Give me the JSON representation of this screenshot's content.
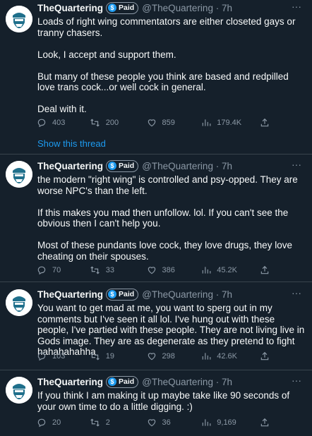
{
  "tweets": [
    {
      "name": "TheQuartering",
      "badge": "Paid",
      "badge_icon": "$",
      "handle": "@TheQuartering · 7h",
      "paragraphs": [
        "Loads of right wing commentators are either closeted gays or tranny chasers.",
        "Look, I accept and support them.",
        "But many of these people you think are based and redpilled love trans cock...or well cock in general.",
        "Deal with it."
      ],
      "replies": "403",
      "retweets": "200",
      "likes": "859",
      "views": "179.4K"
    },
    {
      "name": "TheQuartering",
      "badge": "Paid",
      "badge_icon": "$",
      "handle": "@TheQuartering · 7h",
      "paragraphs": [
        "the modern \"right wing\" is controlled and psy-opped.  They are worse NPC's than the left.",
        "If this makes you mad then unfollow.  lol.  If you can't see the obvious then I can't help you.",
        "Most of these pundants love cock, they love drugs, they love cheating on their spouses."
      ],
      "replies": "70",
      "retweets": "33",
      "likes": "386",
      "views": "45.2K"
    },
    {
      "name": "TheQuartering",
      "badge": "Paid",
      "badge_icon": "$",
      "handle": "@TheQuartering · 7h",
      "paragraphs": [
        "You want to get  mad at me, you want to sperg out in my comments but I've seen it all lol.  I've hung out with these people, I've partied with these people.  They are not living live in Gods image.  They are as degenerate as they pretend to fight hahahahahha"
      ],
      "replies": "103",
      "retweets": "19",
      "likes": "298",
      "views": "42.6K"
    },
    {
      "name": "TheQuartering",
      "badge": "Paid",
      "badge_icon": "$",
      "handle": "@TheQuartering · 7h",
      "paragraphs": [
        "If you think I am making it up maybe take like 90 seconds of your own time to do a little digging. :)"
      ],
      "replies": "20",
      "retweets": "2",
      "likes": "36",
      "views": "9,169"
    }
  ],
  "show_thread_label": "Show this thread",
  "more_icon": "···",
  "icons": {
    "reply": "reply-icon",
    "retweet": "retweet-icon",
    "like": "heart-icon",
    "views": "views-icon",
    "share": "share-icon",
    "avatar": "avatar-logo",
    "paid": "paid-badge-icon"
  },
  "colors": {
    "background": "#15202b",
    "text": "#f7f9f9",
    "muted": "#8b98a5",
    "accent": "#1d9bf0",
    "divider": "#38444d"
  }
}
